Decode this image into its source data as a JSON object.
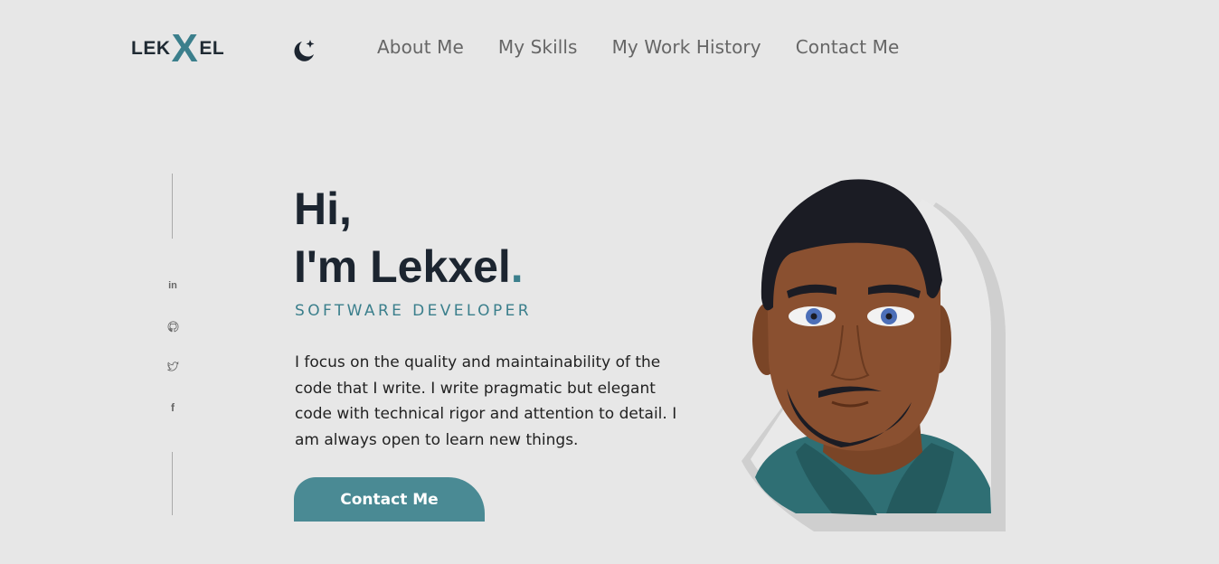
{
  "brand": {
    "logo_left": "LEK",
    "logo_x": "X",
    "logo_right": "EL"
  },
  "header": {
    "theme_toggle_icon": "moon-stars-icon",
    "nav": [
      {
        "label": "About Me"
      },
      {
        "label": "My Skills"
      },
      {
        "label": "My Work History"
      },
      {
        "label": "Contact Me"
      }
    ]
  },
  "social": [
    {
      "icon": "linkedin-icon",
      "glyph": "in"
    },
    {
      "icon": "github-icon"
    },
    {
      "icon": "twitter-icon"
    },
    {
      "icon": "facebook-icon",
      "glyph": "f"
    }
  ],
  "hero": {
    "greeting_line1": "Hi,",
    "greeting_line2": "I'm Lekxel",
    "greeting_dot": ".",
    "role": "SOFTWARE DEVELOPER",
    "bio": "I focus on the quality and maintainability of the code that I write. I write pragmatic but elegant code with technical rigor and attention to detail. I am always open to learn new things.",
    "cta_label": "Contact Me"
  },
  "colors": {
    "accent": "#3b7f8c",
    "button": "#4a8a94",
    "background": "#e7e7e7",
    "heading": "#1c2530"
  }
}
